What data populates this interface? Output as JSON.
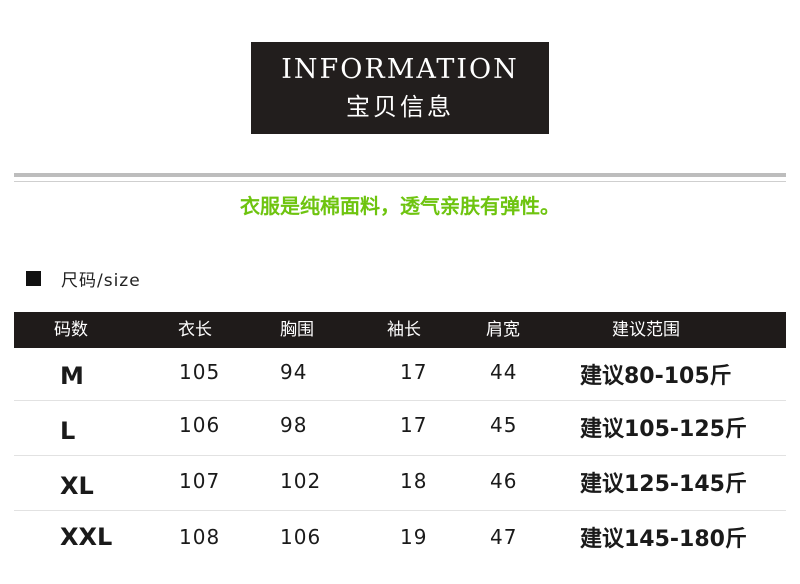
{
  "banner": {
    "title_en": "INFORMATION",
    "title_cn": "宝贝信息"
  },
  "tagline": "衣服是纯棉面料，透气亲肤有弹性。",
  "size_section": {
    "label": "尺码/size"
  },
  "size_table": {
    "headers": [
      "码数",
      "衣长",
      "胸围",
      "袖长",
      "肩宽",
      "建议范围"
    ],
    "rows": [
      [
        "M",
        "105",
        "94",
        "17",
        "44",
        "建议80-105斤"
      ],
      [
        "L",
        "106",
        "98",
        "17",
        "45",
        "建议105-125斤"
      ],
      [
        "XL",
        "107",
        "102",
        "18",
        "46",
        "建议125-145斤"
      ],
      [
        "XXL",
        "108",
        "106",
        "19",
        "47",
        "建议145-180斤"
      ]
    ]
  },
  "colors": {
    "banner_bg": "#221e1d",
    "tagline": "#6ec40f",
    "header_bg": "#1f1b1a"
  }
}
